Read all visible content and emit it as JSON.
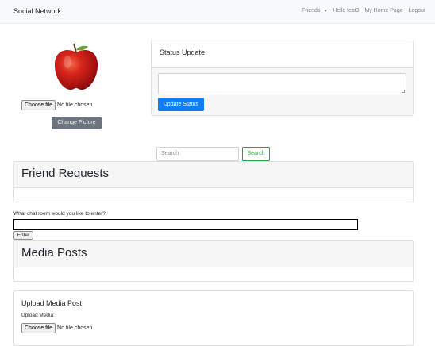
{
  "navbar": {
    "brand": "Social Network",
    "friends": "Friends",
    "greeting": "Hello test3",
    "home": "My Home Page",
    "logout": "Logout"
  },
  "profile": {
    "choose_file": "Choose file",
    "no_file": "No file chosen",
    "change_picture": "Change Picture"
  },
  "status": {
    "title": "Status Update",
    "button": "Update Status"
  },
  "search": {
    "placeholder": "Search",
    "button": "Search"
  },
  "friend_requests": {
    "title": "Friend Requests"
  },
  "chat": {
    "label": "What chat room would you like to enter?",
    "button": "Enter"
  },
  "media_posts": {
    "title": "Media Posts"
  },
  "upload": {
    "title": "Upload Media Post",
    "label": "Upload Media:",
    "choose_file": "Choose file",
    "no_file": "No file chosen"
  },
  "colors": {
    "primary": "#0d7ef5",
    "secondary": "#6c757d",
    "success": "#28a745"
  }
}
